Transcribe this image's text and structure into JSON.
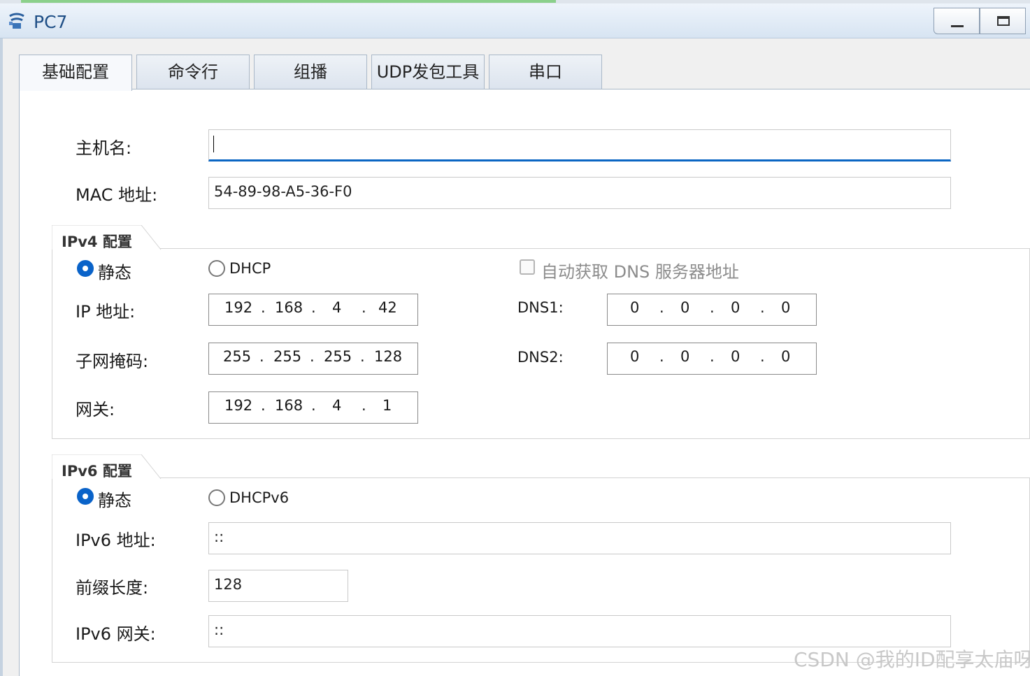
{
  "window": {
    "title": "PC7"
  },
  "tabs": [
    "基础配置",
    "命令行",
    "组播",
    "UDP发包工具",
    "串口"
  ],
  "basic": {
    "hostname_label": "主机名:",
    "hostname_value": "",
    "mac_label": "MAC 地址:",
    "mac_value": "54-89-98-A5-36-F0"
  },
  "ipv4": {
    "group_title": "IPv4 配置",
    "static_label": "静态",
    "dhcp_label": "DHCP",
    "auto_dns_label": "自动获取 DNS 服务器地址",
    "ip_label": "IP 地址:",
    "ip": [
      "192",
      "168",
      "4",
      "42"
    ],
    "mask_label": "子网掩码:",
    "mask": [
      "255",
      "255",
      "255",
      "128"
    ],
    "gateway_label": "网关:",
    "gateway": [
      "192",
      "168",
      "4",
      "1"
    ],
    "dns1_label": "DNS1:",
    "dns1": [
      "0",
      "0",
      "0",
      "0"
    ],
    "dns2_label": "DNS2:",
    "dns2": [
      "0",
      "0",
      "0",
      "0"
    ],
    "mode": "static"
  },
  "ipv6": {
    "group_title": "IPv6 配置",
    "static_label": "静态",
    "dhcp_label": "DHCPv6",
    "addr_label": "IPv6 地址:",
    "addr_value": "::",
    "prefix_label": "前缀长度:",
    "prefix_value": "128",
    "gateway_label": "IPv6 网关:",
    "gateway_value": "::",
    "mode": "static"
  },
  "watermark": "CSDN @我的ID配享太庙呀",
  "colors": {
    "accent": "#0a63c9",
    "title_text": "#1f4f86"
  }
}
